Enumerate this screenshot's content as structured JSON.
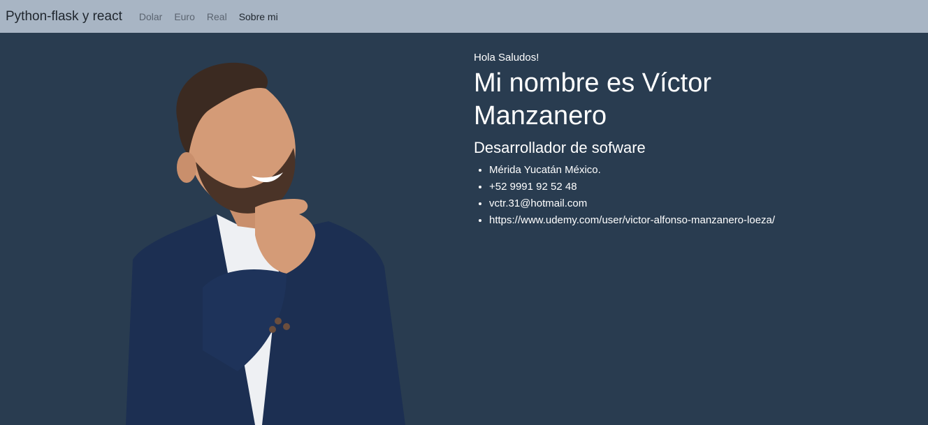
{
  "navbar": {
    "brand": "Python-flask y react",
    "links": [
      {
        "label": "Dolar"
      },
      {
        "label": "Euro"
      },
      {
        "label": "Real"
      },
      {
        "label": "Sobre mi"
      }
    ]
  },
  "profile": {
    "greeting": "Hola Saludos!",
    "name_heading": "Mi nombre es Víctor Manzanero",
    "role": "Desarrollador de sofware",
    "details": [
      "Mérida Yucatán México.",
      "+52 9991 92 52 48",
      "vctr.31@hotmail.com",
      "https://www.udemy.com/user/victor-alfonso-manzanero-loeza/"
    ]
  },
  "colors": {
    "background": "#293c50",
    "navbar": "#a8b5c4",
    "text": "#ffffff"
  }
}
